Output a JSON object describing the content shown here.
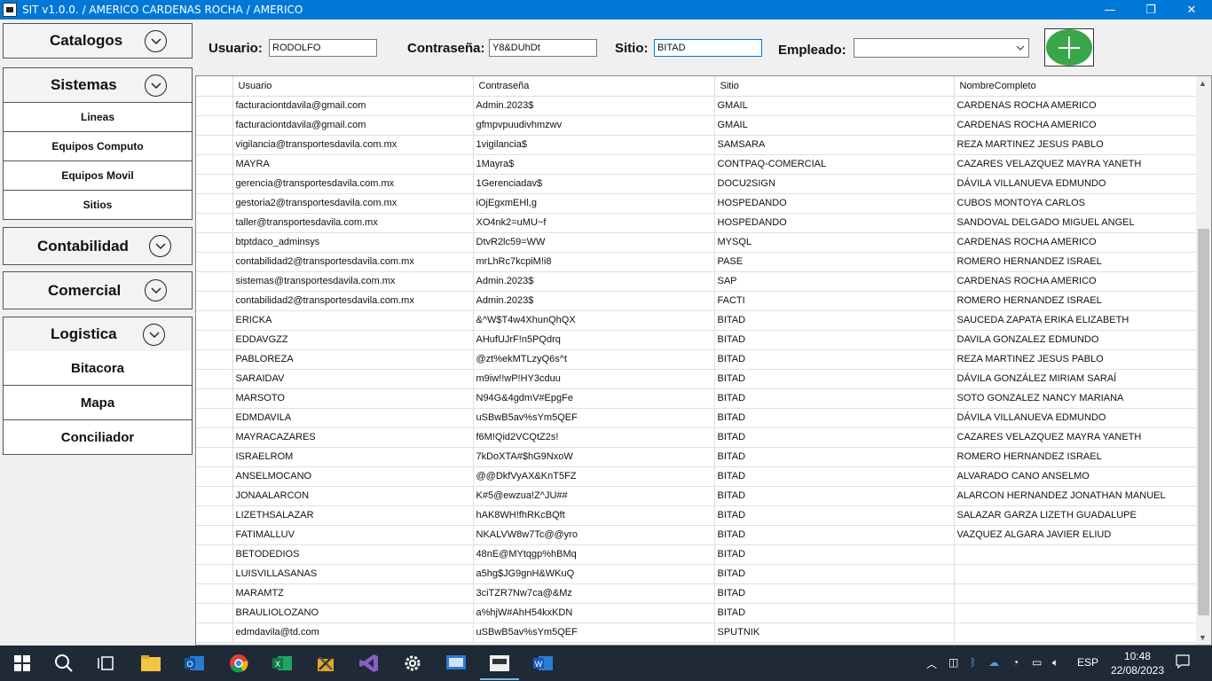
{
  "window": {
    "title": "SIT v1.0.0. / AMERICO CARDENAS ROCHA / AMERICO",
    "minimize": "—",
    "restore": "❐",
    "close": "✕"
  },
  "sidebar": {
    "catalogos": "Catalogos",
    "sistemas": "Sistemas",
    "sistemas_items": [
      "Lineas",
      "Equipos Computo",
      "Equipos Movil",
      "Sitios"
    ],
    "contabilidad": "Contabilidad",
    "comercial": "Comercial",
    "logistica": "Logistica",
    "logistica_items": [
      "Bitacora",
      "Mapa",
      "Conciliador"
    ]
  },
  "form": {
    "usuario_label": "Usuario:",
    "usuario_value": "RODOLFO",
    "contrasena_label": "Contraseña:",
    "contrasena_value": "Y8&DUhDt",
    "sitio_label": "Sitio:",
    "sitio_value": "BITAD",
    "empleado_label": "Empleado:",
    "empleado_value": ""
  },
  "grid": {
    "columns": [
      "Usuario",
      "Contraseña",
      "Sitio",
      "NombreCompleto"
    ],
    "rows": [
      [
        "facturaciontdavila@gmail.com",
        "Admin.2023$",
        "GMAIL",
        "CARDENAS ROCHA AMERICO"
      ],
      [
        "facturaciontdavila@gmail.com",
        "gfmpvpuudivhmzwv",
        "GMAIL",
        "CARDENAS ROCHA AMERICO"
      ],
      [
        "vigilancia@transportesdavila.com.mx",
        "1vigilancia$",
        "SAMSARA",
        "REZA MARTINEZ JESUS PABLO"
      ],
      [
        "MAYRA",
        "1Mayra$",
        "CONTPAQ-COMERCIAL",
        "CAZARES VELAZQUEZ MAYRA YANETH"
      ],
      [
        "gerencia@transportesdavila.com.mx",
        "1Gerenciadav$",
        "DOCU2SIGN",
        "DÁVILA VILLANUEVA EDMUNDO"
      ],
      [
        "gestoria2@transportesdavila.com.mx",
        "iOjEgxmEHl,g",
        "HOSPEDANDO",
        "CUBOS MONTOYA CARLOS"
      ],
      [
        "taller@transportesdavila.com.mx",
        "XO4nk2=uMU~f",
        "HOSPEDANDO",
        "SANDOVAL DELGADO MIGUEL ANGEL"
      ],
      [
        "btptdaco_adminsys",
        "DtvR2lc59=WW",
        "MYSQL",
        "CARDENAS ROCHA AMERICO"
      ],
      [
        "contabilidad2@transportesdavila.com.mx",
        "mrLhRc7kcpiM!i8",
        "PASE",
        "ROMERO HERNANDEZ ISRAEL"
      ],
      [
        "sistemas@transportesdavila.com.mx",
        "Admin.2023$",
        "SAP",
        "CARDENAS ROCHA AMERICO"
      ],
      [
        "contabilidad2@transportesdavila.com.mx",
        "Admin.2023$",
        "FACTI",
        "ROMERO HERNANDEZ ISRAEL"
      ],
      [
        "ERICKA",
        "&^W$T4w4XhunQhQX",
        "BITAD",
        "SAUCEDA ZAPATA ERIKA ELIZABETH"
      ],
      [
        "EDDAVGZZ",
        "AHufUJrF!n5PQdrq",
        "BITAD",
        "DAVILA GONZALEZ EDMUNDO"
      ],
      [
        "PABLOREZA",
        "@zt%ekMTLzyQ6s^t",
        "BITAD",
        "REZA MARTINEZ JESUS PABLO"
      ],
      [
        "SARAIDAV",
        "m9iw!!wP!HY3cduu",
        "BITAD",
        "DÁVILA GONZÁLEZ MIRIAM SARAÍ"
      ],
      [
        "MARSOTO",
        "N94G&4gdmV#EpgFe",
        "BITAD",
        "SOTO GONZALEZ NANCY MARIANA"
      ],
      [
        "EDMDAVILA",
        "uSBwB5av%sYm5QEF",
        "BITAD",
        "DÁVILA VILLANUEVA EDMUNDO"
      ],
      [
        "MAYRACAZARES",
        "f6M!Qid2VCQtZ2s!",
        "BITAD",
        "CAZARES VELAZQUEZ MAYRA YANETH"
      ],
      [
        "ISRAELROM",
        "7kDoXTA#$hG9NxoW",
        "BITAD",
        "ROMERO HERNANDEZ ISRAEL"
      ],
      [
        "ANSELMOCANO",
        "@@DkfVyAX&KnT5FZ",
        "BITAD",
        "ALVARADO CANO ANSELMO"
      ],
      [
        "JONAALARCON",
        "K#5@ewzua!Z^JU##",
        "BITAD",
        "ALARCON HERNANDEZ JONATHAN MANUEL"
      ],
      [
        "LIZETHSALAZAR",
        "hAK8WH!fhRKcBQft",
        "BITAD",
        "SALAZAR GARZA LIZETH GUADALUPE"
      ],
      [
        "FATIMALLUV",
        "NKALVW8w7Tc@@yro",
        "BITAD",
        "VAZQUEZ ALGARA JAVIER ELIUD"
      ],
      [
        "BETODEDIOS",
        "48nE@MYtqgp%hBMq",
        "BITAD",
        ""
      ],
      [
        "LUISVILLASANAS",
        "a5hg$JG9gnH&WKuQ",
        "BITAD",
        ""
      ],
      [
        "MARAMTZ",
        "3ciTZR7Nw7ca@&Mz",
        "BITAD",
        ""
      ],
      [
        "BRAULIOLOZANO",
        "a%hjW#AhH54kxKDN",
        "BITAD",
        ""
      ],
      [
        "edmdavila@td.com",
        "uSBwB5av%sYm5QEF",
        "SPUTNIK",
        ""
      ]
    ]
  },
  "taskbar": {
    "language": "ESP",
    "time": "10:48",
    "date": "22/08/2023"
  }
}
